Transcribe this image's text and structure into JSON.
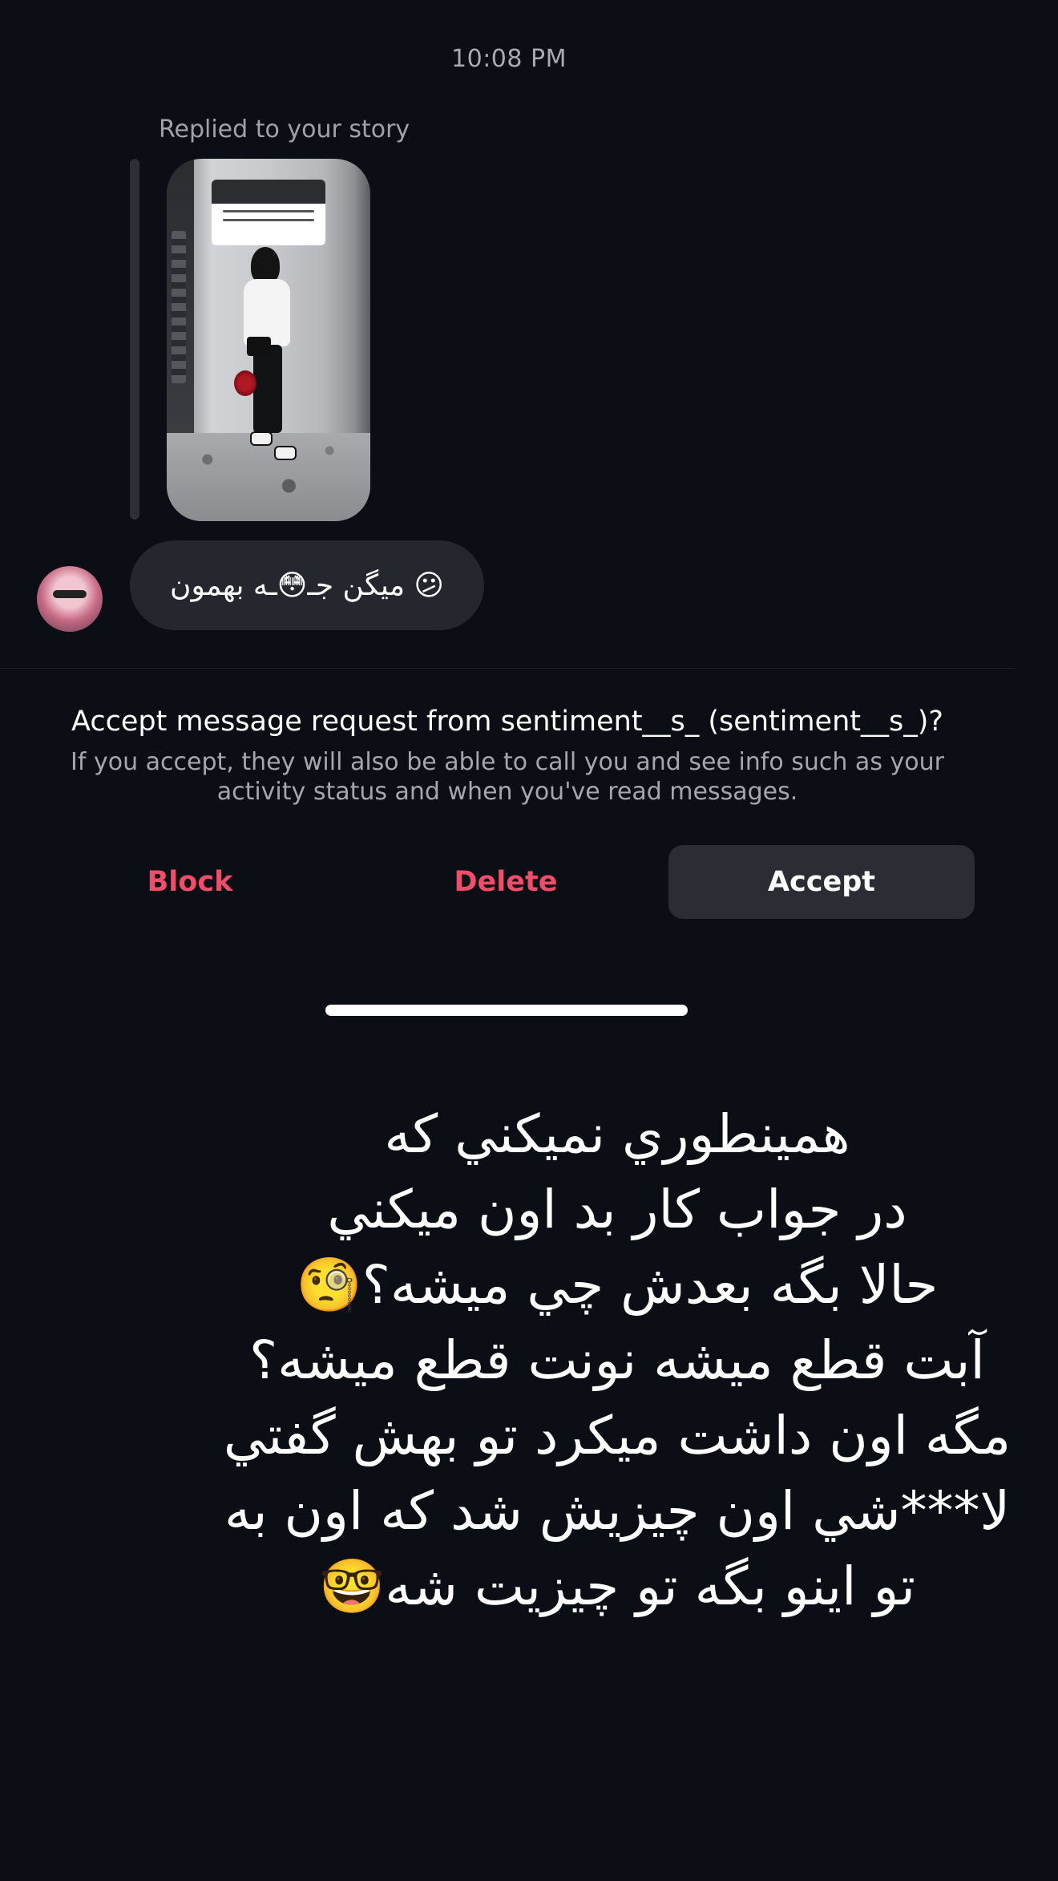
{
  "thread": {
    "timestamp": "10:08 PM",
    "replied_label": "Replied to your story",
    "story_thumbnail_icon": "story-photo",
    "message_text": "😕 میگن جـ😳ـه بهمون"
  },
  "request": {
    "title": "Accept message request from sentiment__s_ (sentiment__s_)?",
    "description": "If you accept, they will also be able to call you and see info such as your activity status and when you've read messages.",
    "block_label": "Block",
    "delete_label": "Delete",
    "accept_label": "Accept"
  },
  "colors": {
    "background": "#0b0e14",
    "destructive": "#ef4d6a",
    "bubble": "#24272d",
    "accept_button": "#2a2d33"
  },
  "overlay": {
    "lines": [
      "همينطوري نميكني كه",
      "در جواب كار بد اون ميكني",
      "حالا بگه بعدش چي ميشه؟🧐",
      "آبت قطع ميشه نونت قطع ميشه؟",
      "مگه اون داشت ميكرد تو بهش گفتي",
      "لا***شي اون چيزيش شد كه اون به",
      "تو اينو بگه تو چيزيت شه🤓"
    ]
  }
}
